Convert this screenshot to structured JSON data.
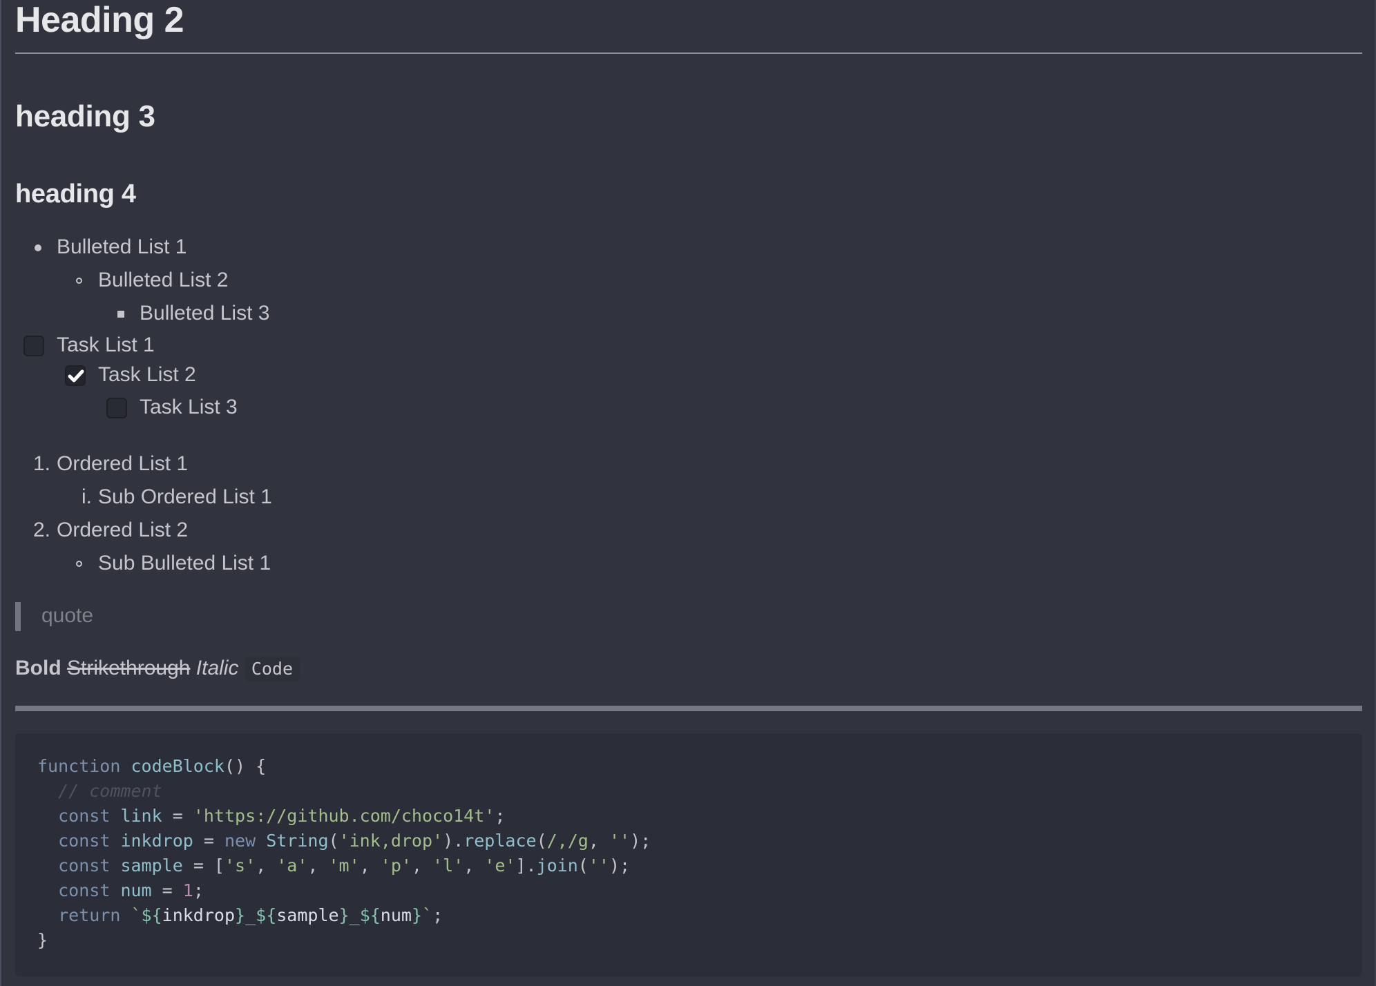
{
  "headings": {
    "h2": "Heading 2",
    "h3": "heading 3",
    "h4": "heading 4"
  },
  "bulleted_list": [
    {
      "label": "Bulleted List 1",
      "level": 1,
      "marker": "disc"
    },
    {
      "label": "Bulleted List 2",
      "level": 2,
      "marker": "circle"
    },
    {
      "label": "Bulleted List 3",
      "level": 3,
      "marker": "square"
    }
  ],
  "task_list": [
    {
      "label": "Task List 1",
      "level": 1,
      "checked": false
    },
    {
      "label": "Task List 2",
      "level": 2,
      "checked": true
    },
    {
      "label": "Task List 3",
      "level": 3,
      "checked": false
    }
  ],
  "ordered_list": [
    {
      "marker": "1.",
      "label": "Ordered List 1",
      "level": 1
    },
    {
      "marker": "i.",
      "label": "Sub Ordered List 1",
      "level": 2
    },
    {
      "marker": "2.",
      "label": "Ordered List 2",
      "level": 1
    },
    {
      "marker": "circle",
      "label": "Sub Bulleted List 1",
      "level": 2
    }
  ],
  "quote": "quote",
  "inline": {
    "bold": "Bold",
    "strikethrough": "Strikethrough",
    "italic": "Italic",
    "code": "Code"
  },
  "code_block": {
    "language": "javascript",
    "lines": [
      "function codeBlock() {",
      "  // comment",
      "  const link = 'https://github.com/choco14t';",
      "  const inkdrop = new String('ink,drop').replace(/,/g, '');",
      "  const sample = ['s', 'a', 'm', 'p', 'l', 'e'].join('');",
      "  const num = 1;",
      "  return `${inkdrop}_${sample}_${num}`;",
      "}"
    ]
  },
  "colors": {
    "background": "#31343f",
    "text": "#c5c6cb",
    "heading": "#e6e7e9",
    "code_background": "#2b2e38",
    "keyword": "#7c90ae",
    "string": "#a3be8c",
    "comment": "#4d5362",
    "number": "#b48ead"
  }
}
